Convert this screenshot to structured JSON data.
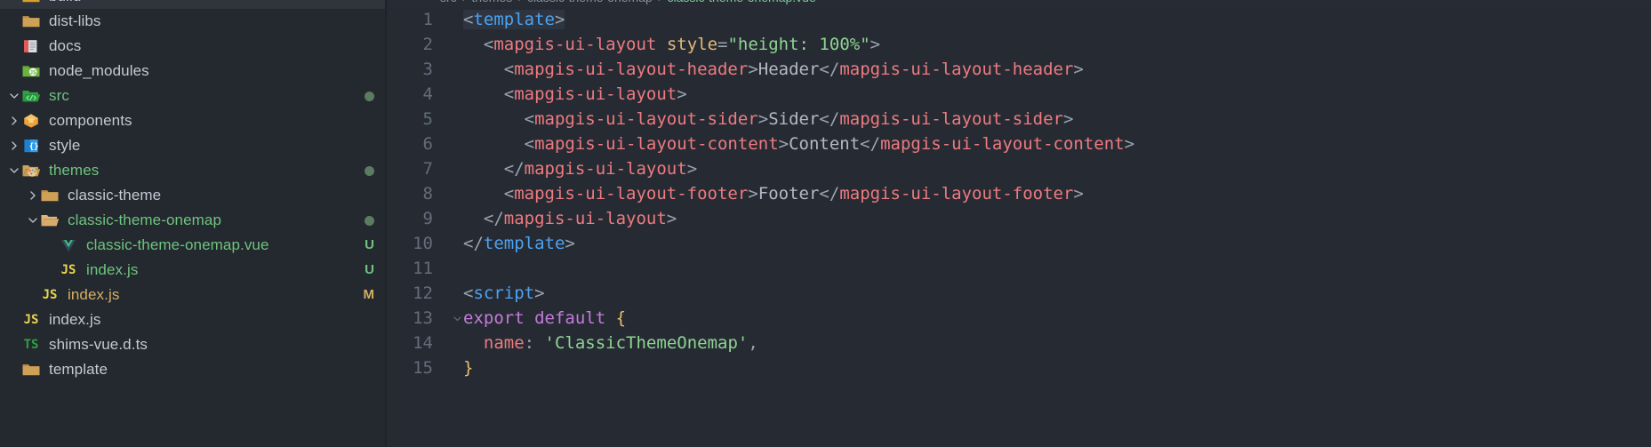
{
  "app": {
    "name": "Visual Studio Code",
    "theme_background": "#262b33",
    "sidebar_background": "#24282f"
  },
  "sidebar": {
    "scroll_partial_top": true,
    "items": [
      {
        "label": "build",
        "type": "folder",
        "icon": "folder-build-icon",
        "indent": 1,
        "twisty": "none",
        "state": "hovered",
        "badge": "",
        "dot": false,
        "git": "none"
      },
      {
        "label": "dist-libs",
        "type": "folder",
        "icon": "folder-dist-icon",
        "indent": 1,
        "twisty": "none",
        "state": "normal",
        "badge": "",
        "dot": false,
        "git": "none"
      },
      {
        "label": "docs",
        "type": "folder",
        "icon": "folder-docs-icon",
        "indent": 1,
        "twisty": "none",
        "state": "normal",
        "badge": "",
        "dot": false,
        "git": "none"
      },
      {
        "label": "node_modules",
        "type": "folder",
        "icon": "folder-node-icon",
        "indent": 1,
        "twisty": "none",
        "state": "normal",
        "badge": "",
        "dot": false,
        "git": "none"
      },
      {
        "label": "src",
        "type": "folder",
        "icon": "folder-src-icon",
        "indent": 1,
        "twisty": "expanded",
        "state": "normal",
        "badge": "",
        "dot": true,
        "git": "untracked"
      },
      {
        "label": "components",
        "type": "folder",
        "icon": "folder-components-icon",
        "indent": 1,
        "twisty": "collapsed",
        "state": "normal",
        "badge": "",
        "dot": false,
        "git": "none"
      },
      {
        "label": "style",
        "type": "folder",
        "icon": "folder-style-icon",
        "indent": 1,
        "twisty": "collapsed",
        "state": "normal",
        "badge": "",
        "dot": false,
        "git": "none"
      },
      {
        "label": "themes",
        "type": "folder",
        "icon": "folder-themes-icon",
        "indent": 1,
        "twisty": "expanded",
        "state": "normal",
        "badge": "",
        "dot": true,
        "git": "untracked"
      },
      {
        "label": "classic-theme",
        "type": "folder",
        "icon": "folder-plain-icon",
        "indent": 2,
        "twisty": "collapsed",
        "state": "normal",
        "badge": "",
        "dot": false,
        "git": "none"
      },
      {
        "label": "classic-theme-onemap",
        "type": "folder",
        "icon": "folder-open-icon",
        "indent": 2,
        "twisty": "expanded",
        "state": "normal",
        "badge": "",
        "dot": true,
        "git": "untracked"
      },
      {
        "label": "classic-theme-onemap.vue",
        "type": "file",
        "icon": "vue-file-icon",
        "indent": 3,
        "twisty": "none",
        "state": "normal",
        "badge": "U",
        "dot": false,
        "git": "untracked"
      },
      {
        "label": "index.js",
        "type": "file",
        "icon": "js-file-icon",
        "indent": 3,
        "twisty": "none",
        "state": "normal",
        "badge": "U",
        "dot": false,
        "git": "untracked"
      },
      {
        "label": "index.js",
        "type": "file",
        "icon": "js-file-icon",
        "indent": 2,
        "twisty": "none",
        "state": "normal",
        "badge": "M",
        "dot": false,
        "git": "modified"
      },
      {
        "label": "index.js",
        "type": "file",
        "icon": "js-file-icon",
        "indent": 1,
        "twisty": "none",
        "state": "normal",
        "badge": "",
        "dot": false,
        "git": "none"
      },
      {
        "label": "shims-vue.d.ts",
        "type": "file",
        "icon": "ts-file-icon",
        "indent": 1,
        "twisty": "none",
        "state": "normal",
        "badge": "",
        "dot": false,
        "git": "none"
      },
      {
        "label": "template",
        "type": "folder",
        "icon": "folder-plain-icon",
        "indent": 1,
        "twisty": "none",
        "state": "normal",
        "badge": "",
        "dot": false,
        "git": "none"
      }
    ]
  },
  "breadcrumbs": {
    "parts": [
      "src",
      "themes",
      "classic-theme-onemap",
      "classic-theme-onemap.vue"
    ]
  },
  "editor": {
    "language": "vue",
    "current_line": 1,
    "lines": [
      {
        "num": "1",
        "fold": "",
        "text": "<template>"
      },
      {
        "num": "2",
        "fold": "",
        "text": "  <mapgis-ui-layout style=\"height: 100%\">"
      },
      {
        "num": "3",
        "fold": "",
        "text": "    <mapgis-ui-layout-header>Header</mapgis-ui-layout-header>"
      },
      {
        "num": "4",
        "fold": "",
        "text": "    <mapgis-ui-layout>"
      },
      {
        "num": "5",
        "fold": "",
        "text": "      <mapgis-ui-layout-sider>Sider</mapgis-ui-layout-sider>"
      },
      {
        "num": "6",
        "fold": "",
        "text": "      <mapgis-ui-layout-content>Content</mapgis-ui-layout-content>"
      },
      {
        "num": "7",
        "fold": "",
        "text": "    </mapgis-ui-layout>"
      },
      {
        "num": "8",
        "fold": "",
        "text": "    <mapgis-ui-layout-footer>Footer</mapgis-ui-layout-footer>"
      },
      {
        "num": "9",
        "fold": "",
        "text": "  </mapgis-ui-layout>"
      },
      {
        "num": "10",
        "fold": "",
        "text": "</template>"
      },
      {
        "num": "11",
        "fold": "",
        "text": ""
      },
      {
        "num": "12",
        "fold": "",
        "text": "<script>"
      },
      {
        "num": "13",
        "fold": "v",
        "text": "export default {"
      },
      {
        "num": "14",
        "fold": "",
        "text": "  name: 'ClassicThemeOnemap',"
      },
      {
        "num": "15",
        "fold": "",
        "text": "}"
      }
    ]
  },
  "colors": {
    "tag": "#ef7a80",
    "keyword_tag": "#4da2f0",
    "attribute": "#e6b877",
    "string": "#8fd492",
    "text_node": "#b2bac5",
    "keyword": "#c57bdb",
    "brace": "#e8c06a",
    "line_number": "#636c79",
    "git_untracked": "#6fc47f",
    "git_modified": "#d4b063"
  }
}
